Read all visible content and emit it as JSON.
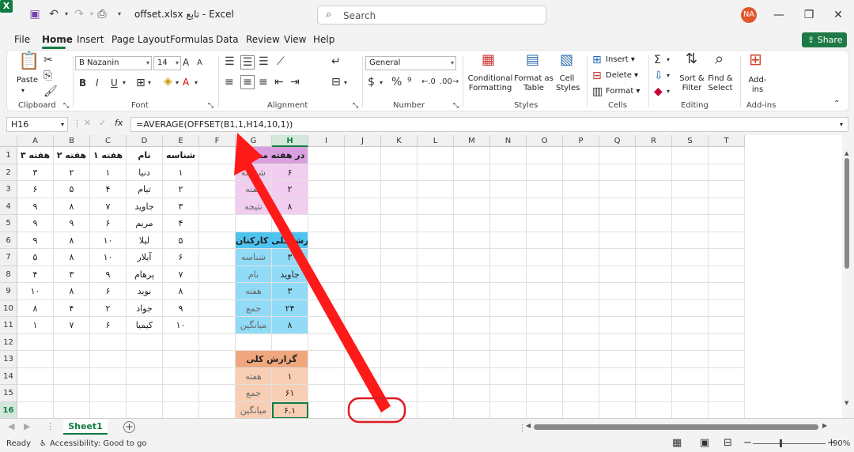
{
  "titlebar": {
    "filename": "offset.xlsx تابع",
    "app": "Excel",
    "search_placeholder": "Search",
    "user_initials": "NA"
  },
  "menu": {
    "tabs": [
      "File",
      "Home",
      "Insert",
      "Page Layout",
      "Formulas",
      "Data",
      "Review",
      "View",
      "Help"
    ],
    "active": "Home",
    "share_label": "Share"
  },
  "ribbon": {
    "clipboard": {
      "label": "Clipboard",
      "paste": "Paste"
    },
    "font": {
      "label": "Font",
      "font_name": "B Nazanin",
      "font_size": "14"
    },
    "alignment": {
      "label": "Alignment"
    },
    "number": {
      "label": "Number",
      "format": "General"
    },
    "styles": {
      "label": "Styles",
      "conditional": "Conditional Formatting",
      "format_table": "Format as Table",
      "cell_styles": "Cell Styles"
    },
    "cells": {
      "label": "Cells",
      "insert": "Insert",
      "delete": "Delete",
      "format": "Format"
    },
    "editing": {
      "label": "Editing",
      "sort_filter": "Sort & Filter",
      "find_select": "Find & Select"
    },
    "addins": {
      "label": "Add-ins",
      "addins": "Add-ins"
    }
  },
  "formula_bar": {
    "name_box": "H16",
    "formula": "=AVERAGE(OFFSET(B1,1,H14,10,1))"
  },
  "grid": {
    "columns": [
      "A",
      "B",
      "C",
      "D",
      "E",
      "F",
      "G",
      "H",
      "I",
      "J",
      "K",
      "L",
      "M",
      "N",
      "O",
      "P",
      "Q",
      "R",
      "S",
      "T"
    ],
    "rows": [
      "1",
      "2",
      "3",
      "4",
      "5",
      "6",
      "7",
      "8",
      "9",
      "10",
      "11",
      "12",
      "13",
      "14",
      "15",
      "16"
    ],
    "selected_column": "H",
    "selected_row": "16",
    "headers": [
      "شناسه",
      "نام",
      "هفته ۱",
      "هفته ۲",
      "هفته ۳"
    ],
    "data": [
      [
        "۱",
        "دنیا",
        "۱",
        "۲",
        "۳"
      ],
      [
        "۲",
        "تیام",
        "۴",
        "۵",
        "۶"
      ],
      [
        "۳",
        "جاوید",
        "۷",
        "۸",
        "۹"
      ],
      [
        "۴",
        "مریم",
        "۶",
        "۹",
        "۹"
      ],
      [
        "۵",
        "لیلا",
        "۱۰",
        "۸",
        "۹"
      ],
      [
        "۶",
        "آیلار",
        "۱۰",
        "۸",
        "۵"
      ],
      [
        "۷",
        "پرهام",
        "۹",
        "۳",
        "۴"
      ],
      [
        "۸",
        "نوید",
        "۶",
        "۸",
        "۱۰"
      ],
      [
        "۹",
        "جواد",
        "۲",
        "۴",
        "۸"
      ],
      [
        "۱۰",
        "کیمیا",
        "۶",
        "۷",
        "۱"
      ]
    ],
    "box1": {
      "title": "تعداد فروش در هفته مشخص",
      "rows": [
        [
          "شناسه",
          "۶"
        ],
        [
          "هفته",
          "۲"
        ],
        [
          "نتیجه",
          "۸"
        ]
      ]
    },
    "box2": {
      "title": "گزارش کلی کارکنان",
      "rows": [
        [
          "شناسه",
          "۳"
        ],
        [
          "نام",
          "جاوید"
        ],
        [
          "هفته",
          "۳"
        ],
        [
          "جمع",
          "۲۴"
        ],
        [
          "میانگین",
          "۸"
        ]
      ]
    },
    "box3": {
      "title": "گزارش کلی",
      "rows": [
        [
          "هفته",
          "۱"
        ],
        [
          "جمع",
          "۶۱"
        ],
        [
          "میانگین",
          "۶.۱"
        ]
      ]
    },
    "colors": {
      "box1_header": "#d99fde",
      "box1_body": "#f1cdf0",
      "box2_header": "#4fc3ef",
      "box2_body": "#91dbf7",
      "box3_header": "#f0a77e",
      "box3_body": "#f8ceb4",
      "annotation": "#ff1a1a"
    }
  },
  "sheets": {
    "active": "Sheet1"
  },
  "status": {
    "ready": "Ready",
    "accessibility": "Accessibility: Good to go",
    "zoom": "90%"
  }
}
